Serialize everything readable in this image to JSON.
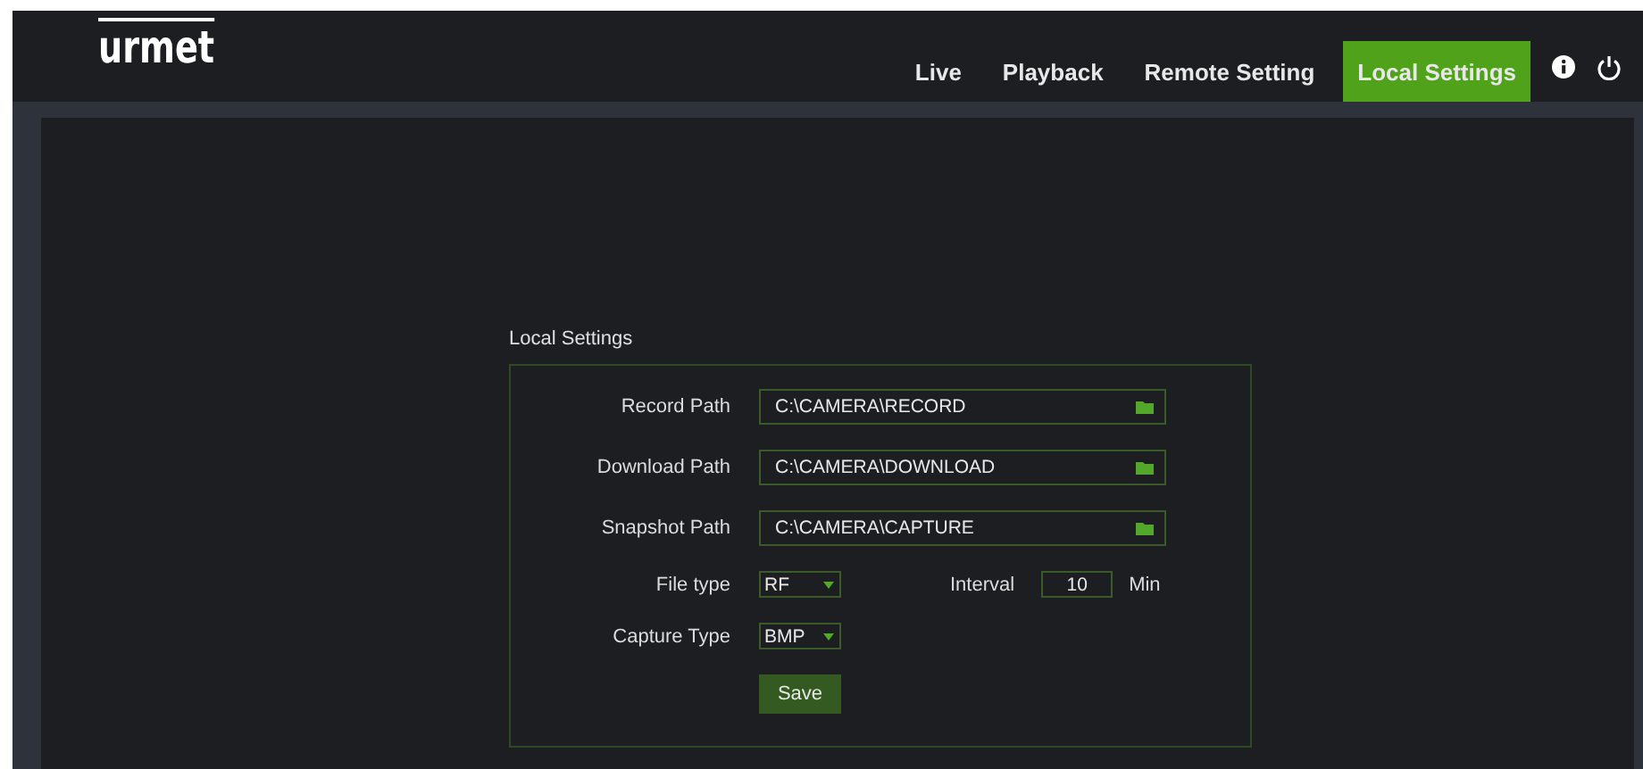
{
  "logo": "urmet",
  "nav": [
    {
      "label": "Live",
      "selected": false
    },
    {
      "label": "Playback",
      "selected": false
    },
    {
      "label": "Remote Setting",
      "selected": false
    },
    {
      "label": "Local Settings",
      "selected": true
    }
  ],
  "section_title": "Local Settings",
  "paths": [
    {
      "label": "Record Path",
      "value": "C:\\CAMERA\\RECORD"
    },
    {
      "label": "Download Path",
      "value": "C:\\CAMERA\\DOWNLOAD"
    },
    {
      "label": "Snapshot Path",
      "value": "C:\\CAMERA\\CAPTURE"
    }
  ],
  "file_type": {
    "label": "File type",
    "value": "RF"
  },
  "interval": {
    "label": "Interval",
    "value": "10",
    "unit": "Min"
  },
  "capture_type": {
    "label": "Capture Type",
    "value": "BMP"
  },
  "save_button": "Save"
}
